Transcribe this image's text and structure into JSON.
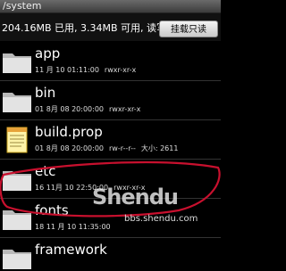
{
  "window": {
    "path": "/system"
  },
  "storage": {
    "info": "204.16MB 已用, 3.34MB 可用, 读写",
    "mount_button": "挂载只读"
  },
  "files": [
    {
      "name": "app",
      "type": "folder",
      "date": "11 月 10 01:11:00",
      "perms": "rwxr-xr-x",
      "size": ""
    },
    {
      "name": "bin",
      "type": "folder",
      "date": "01 8月 08 20:00:00",
      "perms": "rwxr-xr-x",
      "size": ""
    },
    {
      "name": "build.prop",
      "type": "file",
      "date": "01 8月 08 20:00:00",
      "perms": "rw-r--r--",
      "size": "大小: 2611"
    },
    {
      "name": "etc",
      "type": "folder",
      "date": "16 11月 10 22:50:00",
      "perms": "rwxr-xr-x",
      "size": ""
    },
    {
      "name": "fonts",
      "type": "folder",
      "date": "18 11 月 10 11:35:00",
      "perms": "",
      "size": ""
    },
    {
      "name": "framework",
      "type": "folder",
      "date": "",
      "perms": "",
      "size": ""
    }
  ],
  "watermark": {
    "brand": "Shendu",
    "url": "bbs.shendu.com"
  },
  "colors": {
    "annotation": "#c8102e",
    "background": "#000000"
  }
}
